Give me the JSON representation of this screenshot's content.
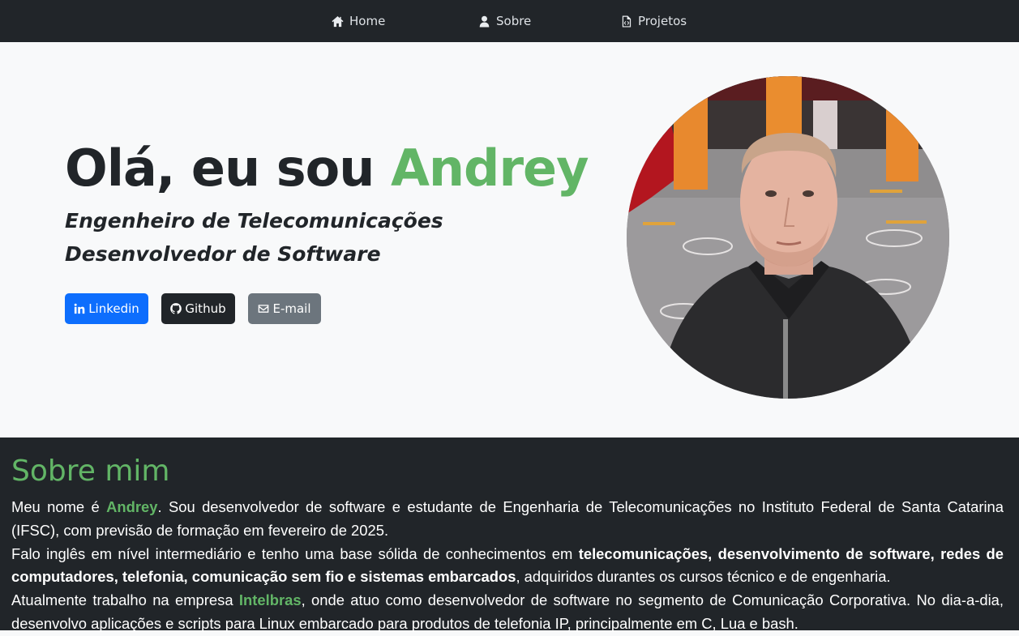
{
  "nav": {
    "items": [
      {
        "label": "Home",
        "icon": "home-icon"
      },
      {
        "label": "Sobre",
        "icon": "user-icon"
      },
      {
        "label": "Projetos",
        "icon": "file-code-icon"
      }
    ]
  },
  "hero": {
    "title_prefix": "Olá, eu sou",
    "title_name": "Andrey",
    "subtitle_1": "Engenheiro de Telecomunicações",
    "subtitle_2": "Desenvolvedor de Software",
    "buttons": {
      "linkedin": "Linkedin",
      "github": "Github",
      "email": "E-mail"
    }
  },
  "about": {
    "title": "Sobre mim",
    "p1": {
      "pre": "Meu nome é ",
      "name": "Andrey",
      "post": ". Sou desenvolvedor de software e estudante de Engenharia de Telecomunicações no Instituto Federal de Santa Catarina (IFSC), com previsão de formação em fevereiro de 2025."
    },
    "p2": {
      "pre": "Falo inglês em nível intermediário e tenho uma base sólida de conhecimentos em ",
      "bold": "telecomunicações, desenvolvimento de software, redes de computadores, telefonia, comunicação sem fio e sistemas embarcados",
      "post": ", adquiridos durantes os cursos técnico e de engenharia."
    },
    "p3": {
      "pre": "Atualmente trabalho na empresa ",
      "company": "Intelbras",
      "post": ", onde atuo como desenvolvedor de software no segmento de Comunicação Corporativa. No dia-a-dia, desenvolvo aplicações e scripts para Linux embarcado para produtos de telefonia IP, principalmente em C, Lua e bash."
    }
  },
  "colors": {
    "accent": "#62b566",
    "dark": "#212529",
    "primary": "#0d6efd",
    "secondary": "#6c757d",
    "light": "#f8f9fa"
  }
}
